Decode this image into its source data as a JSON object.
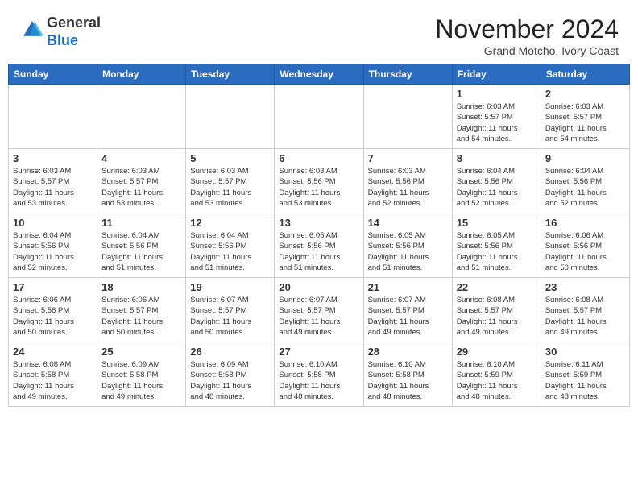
{
  "header": {
    "logo_general": "General",
    "logo_blue": "Blue",
    "month": "November 2024",
    "location": "Grand Motcho, Ivory Coast"
  },
  "weekdays": [
    "Sunday",
    "Monday",
    "Tuesday",
    "Wednesday",
    "Thursday",
    "Friday",
    "Saturday"
  ],
  "weeks": [
    [
      {
        "day": "",
        "info": ""
      },
      {
        "day": "",
        "info": ""
      },
      {
        "day": "",
        "info": ""
      },
      {
        "day": "",
        "info": ""
      },
      {
        "day": "",
        "info": ""
      },
      {
        "day": "1",
        "info": "Sunrise: 6:03 AM\nSunset: 5:57 PM\nDaylight: 11 hours\nand 54 minutes."
      },
      {
        "day": "2",
        "info": "Sunrise: 6:03 AM\nSunset: 5:57 PM\nDaylight: 11 hours\nand 54 minutes."
      }
    ],
    [
      {
        "day": "3",
        "info": "Sunrise: 6:03 AM\nSunset: 5:57 PM\nDaylight: 11 hours\nand 53 minutes."
      },
      {
        "day": "4",
        "info": "Sunrise: 6:03 AM\nSunset: 5:57 PM\nDaylight: 11 hours\nand 53 minutes."
      },
      {
        "day": "5",
        "info": "Sunrise: 6:03 AM\nSunset: 5:57 PM\nDaylight: 11 hours\nand 53 minutes."
      },
      {
        "day": "6",
        "info": "Sunrise: 6:03 AM\nSunset: 5:56 PM\nDaylight: 11 hours\nand 53 minutes."
      },
      {
        "day": "7",
        "info": "Sunrise: 6:03 AM\nSunset: 5:56 PM\nDaylight: 11 hours\nand 52 minutes."
      },
      {
        "day": "8",
        "info": "Sunrise: 6:04 AM\nSunset: 5:56 PM\nDaylight: 11 hours\nand 52 minutes."
      },
      {
        "day": "9",
        "info": "Sunrise: 6:04 AM\nSunset: 5:56 PM\nDaylight: 11 hours\nand 52 minutes."
      }
    ],
    [
      {
        "day": "10",
        "info": "Sunrise: 6:04 AM\nSunset: 5:56 PM\nDaylight: 11 hours\nand 52 minutes."
      },
      {
        "day": "11",
        "info": "Sunrise: 6:04 AM\nSunset: 5:56 PM\nDaylight: 11 hours\nand 51 minutes."
      },
      {
        "day": "12",
        "info": "Sunrise: 6:04 AM\nSunset: 5:56 PM\nDaylight: 11 hours\nand 51 minutes."
      },
      {
        "day": "13",
        "info": "Sunrise: 6:05 AM\nSunset: 5:56 PM\nDaylight: 11 hours\nand 51 minutes."
      },
      {
        "day": "14",
        "info": "Sunrise: 6:05 AM\nSunset: 5:56 PM\nDaylight: 11 hours\nand 51 minutes."
      },
      {
        "day": "15",
        "info": "Sunrise: 6:05 AM\nSunset: 5:56 PM\nDaylight: 11 hours\nand 51 minutes."
      },
      {
        "day": "16",
        "info": "Sunrise: 6:06 AM\nSunset: 5:56 PM\nDaylight: 11 hours\nand 50 minutes."
      }
    ],
    [
      {
        "day": "17",
        "info": "Sunrise: 6:06 AM\nSunset: 5:56 PM\nDaylight: 11 hours\nand 50 minutes."
      },
      {
        "day": "18",
        "info": "Sunrise: 6:06 AM\nSunset: 5:57 PM\nDaylight: 11 hours\nand 50 minutes."
      },
      {
        "day": "19",
        "info": "Sunrise: 6:07 AM\nSunset: 5:57 PM\nDaylight: 11 hours\nand 50 minutes."
      },
      {
        "day": "20",
        "info": "Sunrise: 6:07 AM\nSunset: 5:57 PM\nDaylight: 11 hours\nand 49 minutes."
      },
      {
        "day": "21",
        "info": "Sunrise: 6:07 AM\nSunset: 5:57 PM\nDaylight: 11 hours\nand 49 minutes."
      },
      {
        "day": "22",
        "info": "Sunrise: 6:08 AM\nSunset: 5:57 PM\nDaylight: 11 hours\nand 49 minutes."
      },
      {
        "day": "23",
        "info": "Sunrise: 6:08 AM\nSunset: 5:57 PM\nDaylight: 11 hours\nand 49 minutes."
      }
    ],
    [
      {
        "day": "24",
        "info": "Sunrise: 6:08 AM\nSunset: 5:58 PM\nDaylight: 11 hours\nand 49 minutes."
      },
      {
        "day": "25",
        "info": "Sunrise: 6:09 AM\nSunset: 5:58 PM\nDaylight: 11 hours\nand 49 minutes."
      },
      {
        "day": "26",
        "info": "Sunrise: 6:09 AM\nSunset: 5:58 PM\nDaylight: 11 hours\nand 48 minutes."
      },
      {
        "day": "27",
        "info": "Sunrise: 6:10 AM\nSunset: 5:58 PM\nDaylight: 11 hours\nand 48 minutes."
      },
      {
        "day": "28",
        "info": "Sunrise: 6:10 AM\nSunset: 5:58 PM\nDaylight: 11 hours\nand 48 minutes."
      },
      {
        "day": "29",
        "info": "Sunrise: 6:10 AM\nSunset: 5:59 PM\nDaylight: 11 hours\nand 48 minutes."
      },
      {
        "day": "30",
        "info": "Sunrise: 6:11 AM\nSunset: 5:59 PM\nDaylight: 11 hours\nand 48 minutes."
      }
    ]
  ]
}
